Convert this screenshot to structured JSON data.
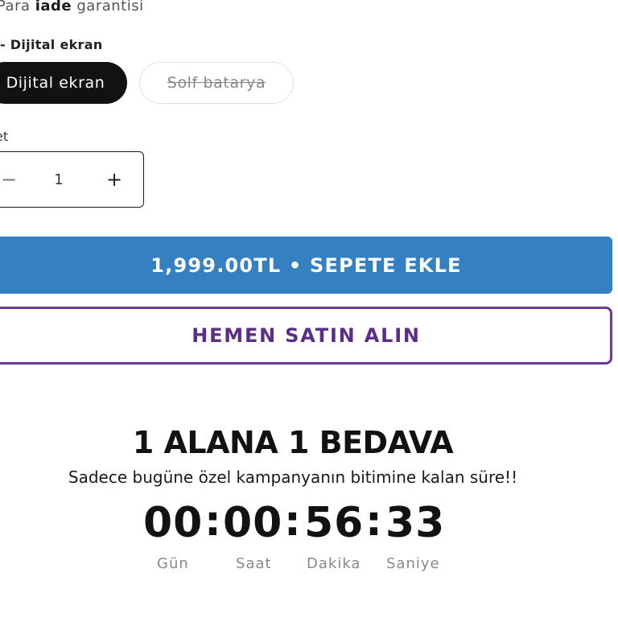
{
  "guarantee": {
    "prefix": "Para ",
    "bold": "iade",
    "suffix": " garantisi"
  },
  "variant": {
    "label": "- Dijital ekran",
    "options": [
      {
        "label": "Dijital ekran",
        "selected": true,
        "available": true
      },
      {
        "label": "Solf batarya",
        "selected": false,
        "available": false
      }
    ]
  },
  "quantity": {
    "label": "et",
    "value": "1",
    "minus_icon": "−",
    "plus_icon": "+"
  },
  "buttons": {
    "add_to_cart": "1,999.00TL • SEPETE EKLE",
    "buy_now": "HEMEN SATIN ALIN"
  },
  "promo": {
    "title": "1 ALANA 1 BEDAVA",
    "subtitle": "Sadece bugüne özel kampanyanın bitimine kalan süre!!"
  },
  "countdown": {
    "separator": ":",
    "days": "00",
    "hours": "00",
    "minutes": "56",
    "seconds": "33",
    "labels": {
      "days": "Gün",
      "hours": "Saat",
      "minutes": "Dakika",
      "seconds": "Saniye"
    }
  },
  "colors": {
    "primary_button": "#3480c1",
    "secondary_border": "#6b3a94",
    "selected_pill": "#121212"
  }
}
